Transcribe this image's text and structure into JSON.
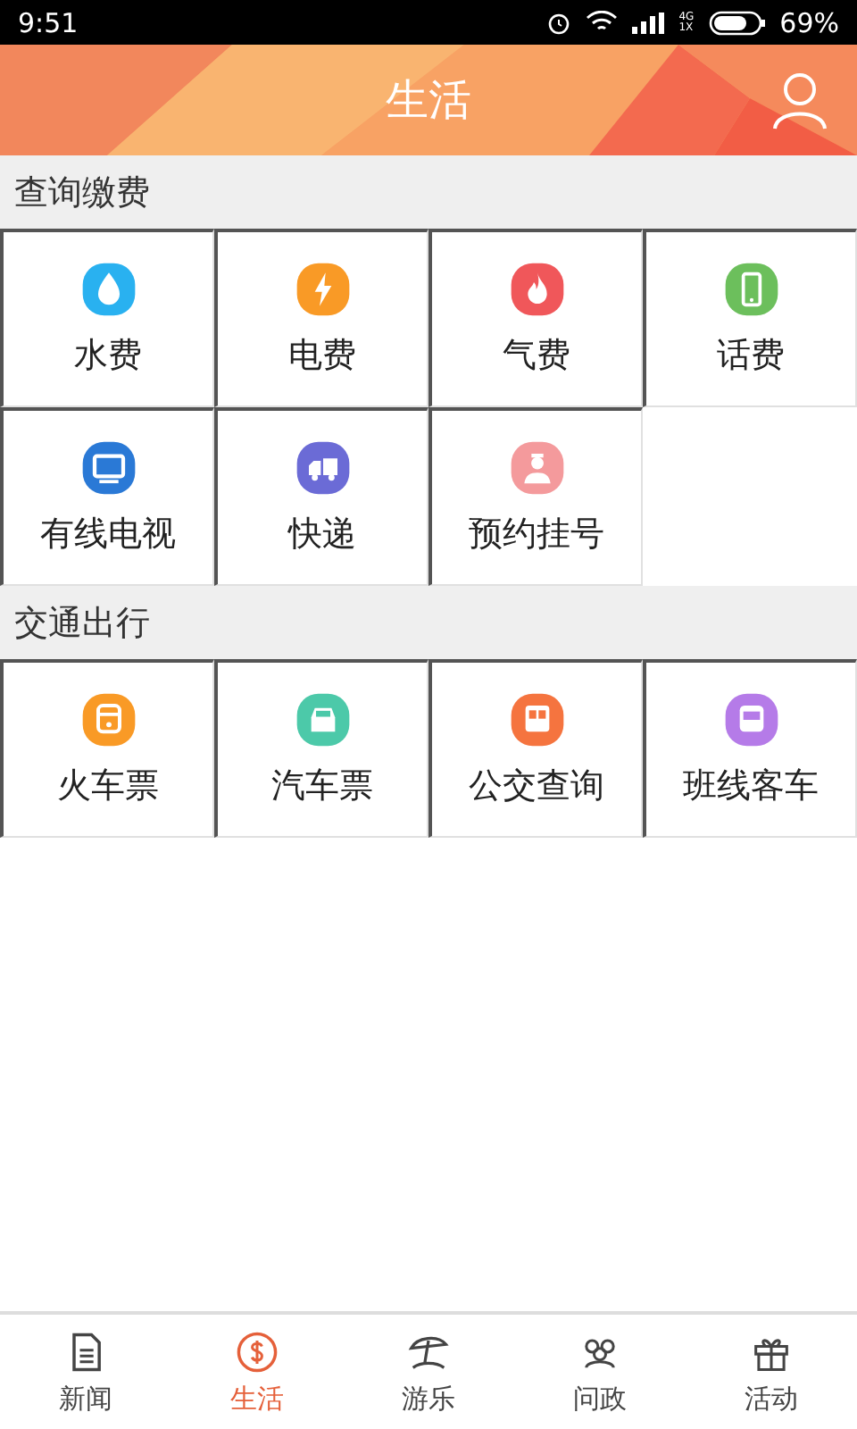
{
  "status_bar": {
    "time": "9:51",
    "network": "4G\n1X",
    "battery": "69%"
  },
  "header": {
    "title": "生活"
  },
  "sections": [
    {
      "title": "查询缴费",
      "items": [
        {
          "label": "水费",
          "kind": "water",
          "color": "#29b1f0"
        },
        {
          "label": "电费",
          "kind": "bolt",
          "color": "#f99a26"
        },
        {
          "label": "气费",
          "kind": "flame",
          "color": "#f0575a"
        },
        {
          "label": "话费",
          "kind": "phone",
          "color": "#6cbf5c"
        },
        {
          "label": "有线电视",
          "kind": "tv",
          "color": "#2a79d6"
        },
        {
          "label": "快递",
          "kind": "truck",
          "color": "#6b6bd6"
        },
        {
          "label": "预约挂号",
          "kind": "doctor",
          "color": "#f49a9c"
        }
      ]
    },
    {
      "title": "交通出行",
      "items": [
        {
          "label": "火车票",
          "kind": "train",
          "color": "#f99a26"
        },
        {
          "label": "汽车票",
          "kind": "car",
          "color": "#4cc9a9"
        },
        {
          "label": "公交查询",
          "kind": "bus",
          "color": "#f5743f"
        },
        {
          "label": "班线客车",
          "kind": "coach",
          "color": "#b57be8"
        }
      ]
    }
  ],
  "tabs": [
    {
      "label": "新闻",
      "kind": "news",
      "selected": false
    },
    {
      "label": "生活",
      "kind": "money",
      "selected": true
    },
    {
      "label": "游乐",
      "kind": "umbrella",
      "selected": false
    },
    {
      "label": "问政",
      "kind": "people",
      "selected": false
    },
    {
      "label": "活动",
      "kind": "gift",
      "selected": false
    }
  ]
}
